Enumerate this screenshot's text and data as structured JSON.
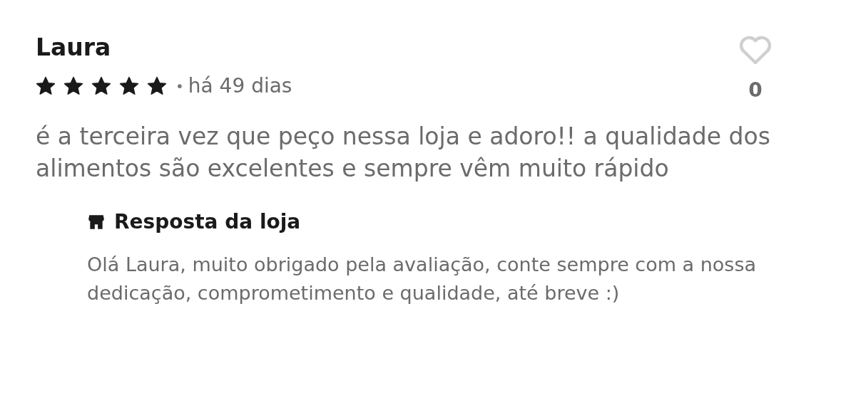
{
  "review": {
    "author": "Laura",
    "stars": 5,
    "separator": "•",
    "date": "há 49 dias",
    "liked": false,
    "like_count": "0",
    "text": "é a terceira vez que peço nessa loja e adoro!! a qualidade dos alimentos são excelentes e sempre vêm muito rápido"
  },
  "store_reply": {
    "title": "Resposta da loja",
    "text": "Olá Laura, muito obrigado pela avaliação, conte sempre com a nossa dedicação, comprometimento e qualidade, até breve :)"
  }
}
